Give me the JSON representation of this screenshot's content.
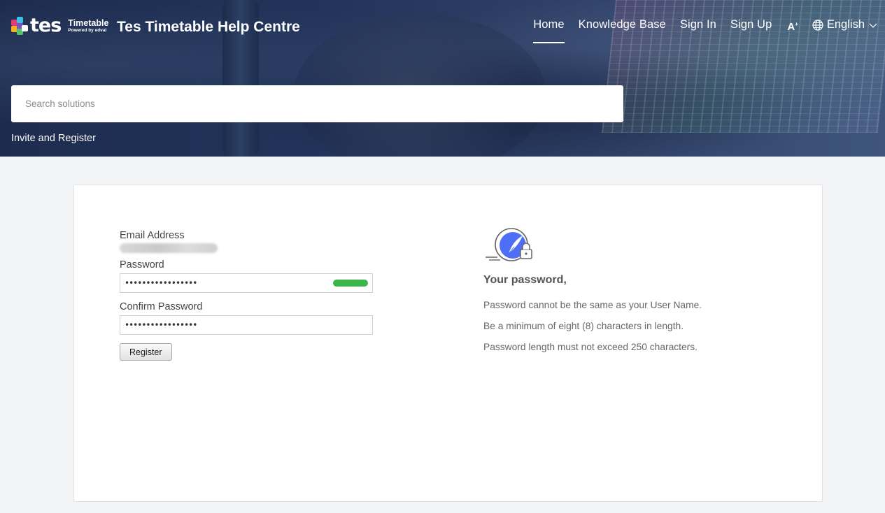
{
  "header": {
    "logo_word": "tes",
    "logo_product": "Timetable",
    "logo_tagline": "Powered by edval",
    "site_title": "Tes Timetable Help Centre",
    "nav": {
      "home": "Home",
      "knowledge_base": "Knowledge Base",
      "sign_in": "Sign In",
      "sign_up": "Sign Up",
      "font_size_icon": "A",
      "language": "English"
    },
    "search_placeholder": "Search solutions",
    "breadcrumb": "Invite and Register"
  },
  "form": {
    "email_label": "Email Address",
    "email_value": "••••••••••••••••••••",
    "password_label": "Password",
    "password_value": "•••••••••••••••••",
    "confirm_label": "Confirm Password",
    "confirm_value": "•••••••••••••••••",
    "password_strength_color": "#3cb64a",
    "register_label": "Register"
  },
  "rules": {
    "heading": "Your password,",
    "items": [
      "Password cannot be the same as your User Name.",
      "Be a minimum of eight (8) characters in length.",
      "Password length must not exceed 250 characters."
    ],
    "icon": "password-lock-illustration-icon"
  }
}
